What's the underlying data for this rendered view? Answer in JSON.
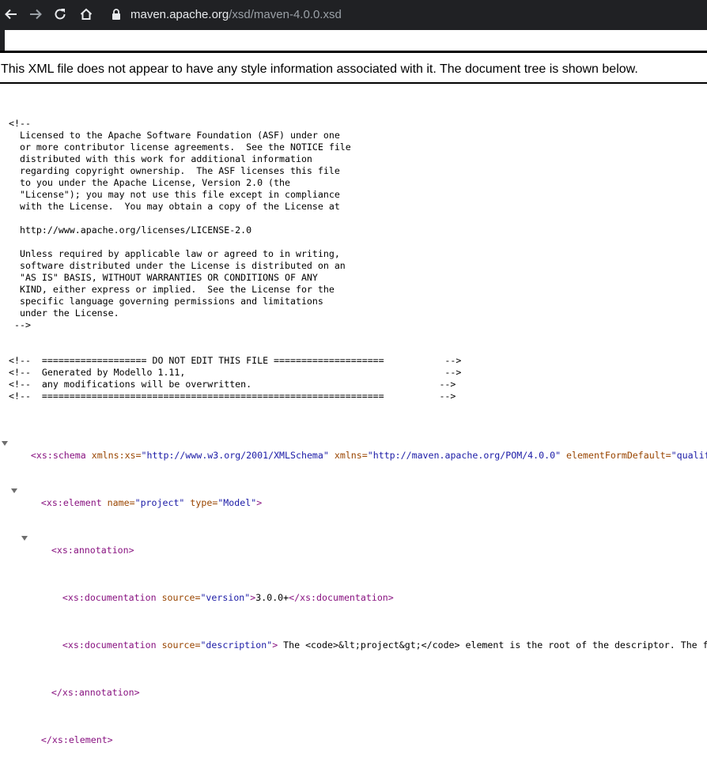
{
  "browser": {
    "url_host": "maven.apache.org",
    "url_path": "/xsd/maven-4.0.0.xsd",
    "icons": [
      "back-arrow-icon",
      "forward-arrow-icon",
      "reload-icon",
      "home-icon",
      "lock-icon"
    ]
  },
  "viewer": {
    "info_text": "This XML file does not appear to have any style information associated with it. The document tree is shown below."
  },
  "license_comment": [
    "<!--",
    "  Licensed to the Apache Software Foundation (ASF) under one",
    "  or more contributor license agreements.  See the NOTICE file",
    "  distributed with this work for additional information",
    "  regarding copyright ownership.  The ASF licenses this file",
    "  to you under the Apache License, Version 2.0 (the",
    "  \"License\"); you may not use this file except in compliance",
    "  with the License.  You may obtain a copy of the License at",
    "",
    "  http://www.apache.org/licenses/LICENSE-2.0",
    "",
    "  Unless required by applicable law or agreed to in writing,",
    "  software distributed under the License is distributed on an",
    "  \"AS IS\" BASIS, WITHOUT WARRANTIES OR CONDITIONS OF ANY",
    "  KIND, either express or implied.  See the License for the",
    "  specific language governing permissions and limitations",
    "  under the License.",
    " -->"
  ],
  "modello_comments": [
    "<!--  =================== DO NOT EDIT THIS FILE ====================           -->",
    "<!--  Generated by Modello 1.11,                                               -->",
    "<!--  any modifications will be overwritten.                                  -->",
    "<!--  ==============================================================          -->"
  ],
  "schema": {
    "open_tag": "<xs:schema",
    "attr1_name": " xmlns:xs=",
    "attr1_val": "\"http://www.w3.org/2001/XMLSchema\"",
    "attr2_name": " xmlns=",
    "attr2_val": "\"http://maven.apache.org/POM/4.0.0\"",
    "attr3_name": " elementFormDefault=",
    "attr3_val": "\"qualified\""
  },
  "element": {
    "open_tag": "<xs:element",
    "attr1_name": " name=",
    "attr1_val": "\"project\"",
    "attr2_name": " type=",
    "attr2_val": "\"Model\"",
    "close": ">",
    "end_tag": "</xs:element>"
  },
  "annotation": {
    "open_tag": "<xs:annotation>",
    "end_tag": "</xs:annotation>"
  },
  "doc1": {
    "open_tag": "<xs:documentation",
    "attr_name": " source=",
    "attr_val": "\"version\"",
    "gt": ">",
    "text": "3.0.0+",
    "end_tag": "</xs:documentation>"
  },
  "doc2": {
    "open_tag": "<xs:documentation",
    "attr_name": " source=",
    "attr_val": "\"description\"",
    "gt": ">",
    "text": " The <code>&lt;project&gt;</code> element is the root of the descriptor. The follo"
  }
}
